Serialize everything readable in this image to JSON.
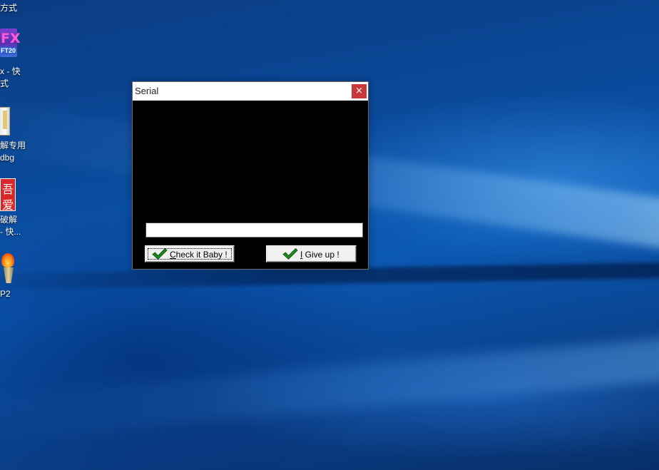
{
  "desktop": {
    "icons": [
      {
        "name": "shortcut-top",
        "lines": [
          "方式"
        ]
      },
      {
        "name": "foxit",
        "badge": "FX",
        "badge_sub": "FT20",
        "lines": [
          "x - 快",
          "式"
        ]
      },
      {
        "name": "ollydbg",
        "lines": [
          "解专用",
          "dbg"
        ]
      },
      {
        "name": "52pojie",
        "glyphs": [
          "吾",
          "爱"
        ],
        "lines": [
          "破解",
          "- 快..."
        ]
      },
      {
        "name": "torch-app",
        "lines": [
          "P2"
        ]
      }
    ]
  },
  "dialog": {
    "title": "Serial",
    "close_glyph": "×",
    "serial_value": "",
    "check_button": {
      "mnemonic": "C",
      "rest": "heck it Baby !"
    },
    "giveup_button": {
      "mnemonic": "I",
      "rest": " Give up !"
    }
  },
  "colors": {
    "close_button": "#c9383b",
    "check_icon": "#1a8a1a",
    "client_background": "#000000"
  }
}
